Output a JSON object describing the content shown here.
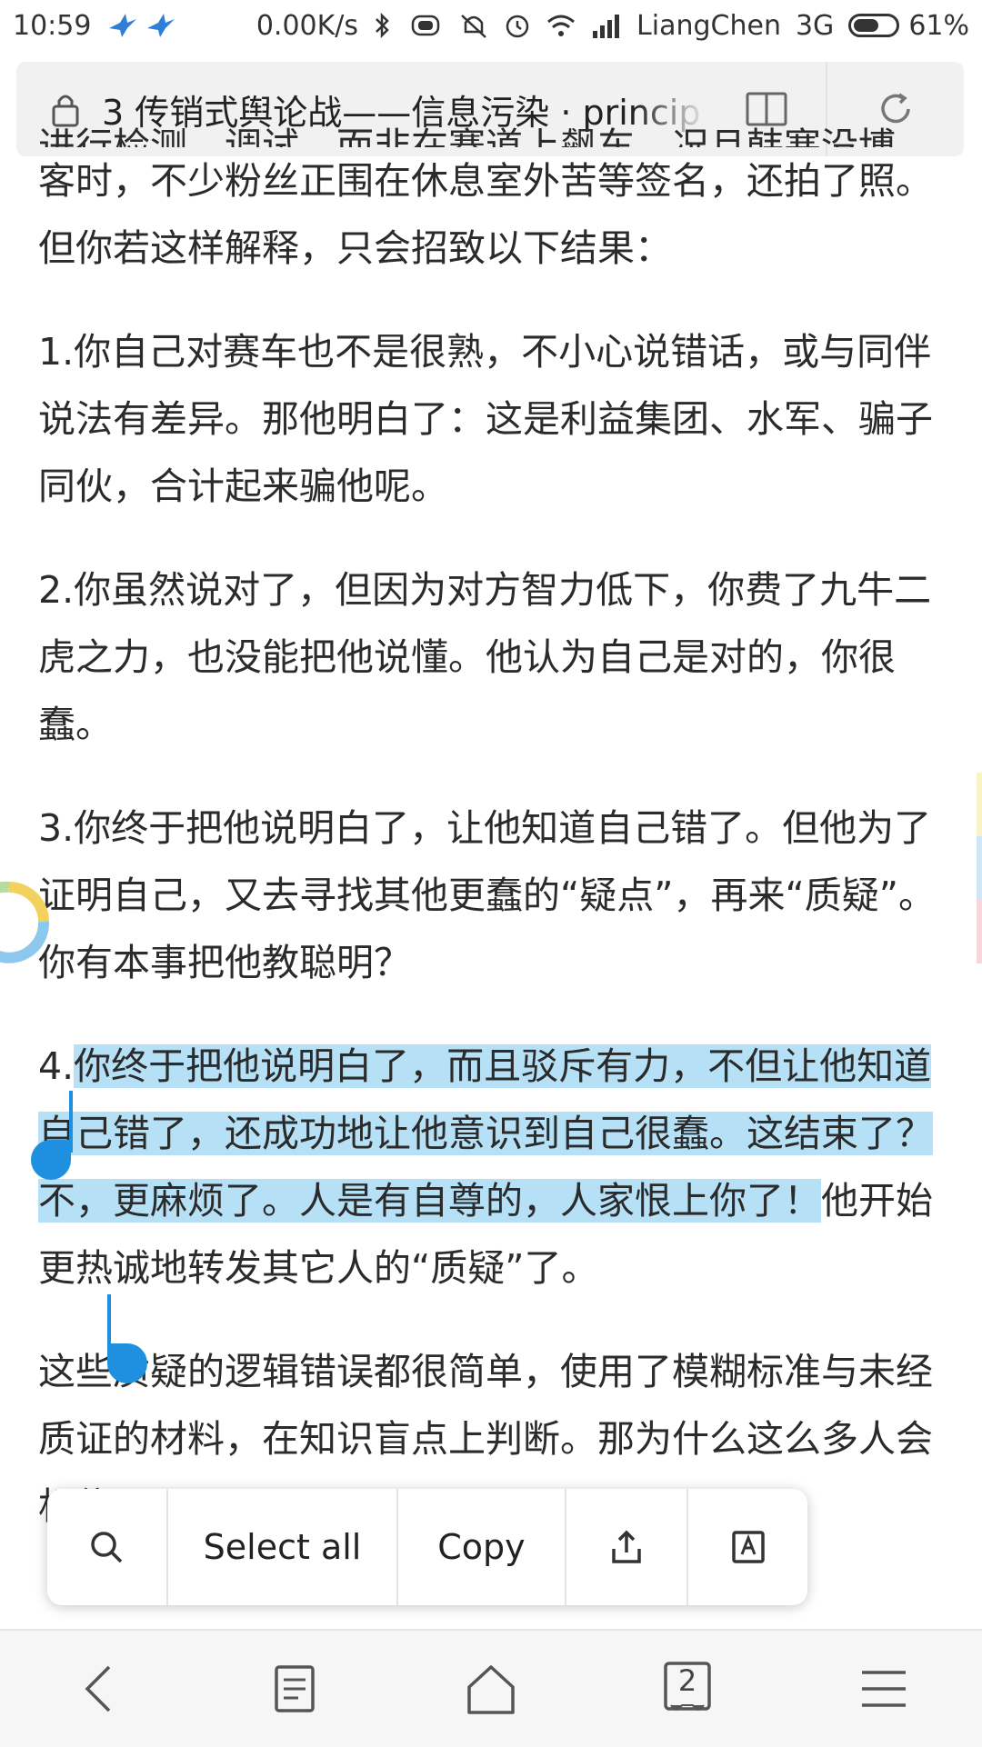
{
  "status_bar": {
    "time": "10:59",
    "net_speed": "0.00K/s",
    "carrier": "LiangChen",
    "network": "3G",
    "battery_percent": "61%",
    "battery_level": 0.61
  },
  "address_bar": {
    "title": "3 传销式舆论战——信息污染 · princip"
  },
  "content": {
    "cut_top": "进行检测、调试，而非在赛道上飙车。况且韩寒没博",
    "para0": "客时，不少粉丝正围在休息室外苦等签名，还拍了照。但你若这样解释，只会招致以下结果：",
    "para1": "1.你自己对赛车也不是很熟，不小心说错话，或与同伴说法有差异。那他明白了：这是利益集团、水军、骗子同伙，合计起来骗他呢。",
    "para2": "2.你虽然说对了，但因为对方智力低下，你费了九牛二虎之力，也没能把他说懂。他认为自己是对的，你很蠢。",
    "para3": "3.你终于把他说明白了，让他知道自己错了。但他为了证明自己，又去寻找其他更蠢的“疑点”，再来“质疑”。你有本事把他教聪明？",
    "para4_prefix": "4.",
    "para4_selected": "你终于把他说明白了，而且驳斥有力，不但让他知道自己错了，还成功地让他意识到自己很蠢。这结束了？不，更麻烦了。人是有自尊的，人家恨上你了！",
    "para4_rest": "他开始更热诚地转发其它人的“质疑”了。",
    "para5": "这些质疑的逻辑错误都很简单，使用了模糊标准与未经质证的材料，在知识盲点上判断。那为什么这么多人会相信呢？"
  },
  "context_menu": {
    "select_all": "Select all",
    "copy": "Copy"
  },
  "bottom_nav": {
    "tabs_count": "2"
  },
  "colors": {
    "selection": "#b6e0f6",
    "handle": "#1f8fe0"
  }
}
